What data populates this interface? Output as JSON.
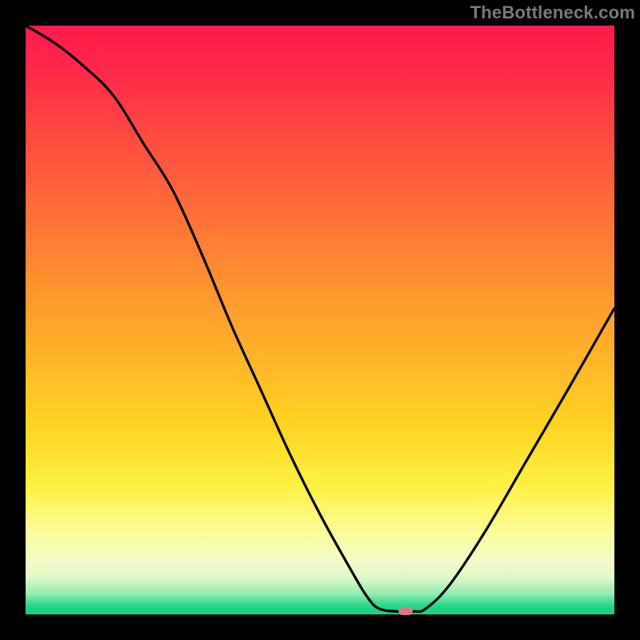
{
  "watermark": "TheBottleneck.com",
  "chart_data": {
    "type": "line",
    "title": "",
    "xlabel": "",
    "ylabel": "",
    "xlim": [
      0,
      100
    ],
    "ylim": [
      0,
      100
    ],
    "curve": [
      {
        "x": 0,
        "y": 100
      },
      {
        "x": 5,
        "y": 97
      },
      {
        "x": 10,
        "y": 93
      },
      {
        "x": 15,
        "y": 88
      },
      {
        "x": 20,
        "y": 80
      },
      {
        "x": 25,
        "y": 72
      },
      {
        "x": 30,
        "y": 61
      },
      {
        "x": 35,
        "y": 49
      },
      {
        "x": 40,
        "y": 38
      },
      {
        "x": 45,
        "y": 27
      },
      {
        "x": 50,
        "y": 17
      },
      {
        "x": 55,
        "y": 8
      },
      {
        "x": 58,
        "y": 3
      },
      {
        "x": 60,
        "y": 1
      },
      {
        "x": 63,
        "y": 0.5
      },
      {
        "x": 66,
        "y": 0.5
      },
      {
        "x": 68,
        "y": 1
      },
      {
        "x": 72,
        "y": 5
      },
      {
        "x": 78,
        "y": 14
      },
      {
        "x": 85,
        "y": 26
      },
      {
        "x": 92,
        "y": 38
      },
      {
        "x": 100,
        "y": 52
      }
    ],
    "minimum_marker": {
      "x": 64.5,
      "y": 0.5,
      "width_pct": 2.4,
      "height_pct": 1.4
    },
    "gradient_stops": [
      {
        "pct": 0,
        "color": "#ff1a4c"
      },
      {
        "pct": 50,
        "color": "#ffb028"
      },
      {
        "pct": 80,
        "color": "#fff060"
      },
      {
        "pct": 100,
        "color": "#15d07e"
      }
    ]
  }
}
